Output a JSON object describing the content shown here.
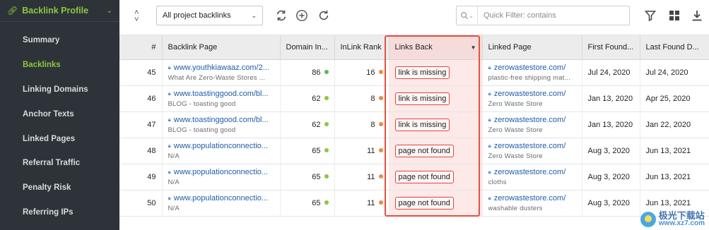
{
  "sidebar": {
    "title": "Backlink Profile",
    "items": [
      {
        "label": "Summary",
        "active": false
      },
      {
        "label": "Backlinks",
        "active": true
      },
      {
        "label": "Linking Domains",
        "active": false
      },
      {
        "label": "Anchor Texts",
        "active": false
      },
      {
        "label": "Linked Pages",
        "active": false
      },
      {
        "label": "Referral Traffic",
        "active": false
      },
      {
        "label": "Penalty Risk",
        "active": false
      },
      {
        "label": "Referring IPs",
        "active": false
      }
    ]
  },
  "toolbar": {
    "select_value": "All project backlinks",
    "filter_placeholder": "Quick Filter: contains"
  },
  "table": {
    "headers": {
      "num": "#",
      "backlink_page": "Backlink Page",
      "domain_inlink": "Domain In...",
      "inlink_rank": "InLink Rank",
      "links_back": "Links Back",
      "linked_page": "Linked Page",
      "first_found": "First Found...",
      "last_found": "Last Found D..."
    },
    "rows": [
      {
        "num": "45",
        "bp_url": "www.youthkiawaaz.com/2...",
        "bp_sub": "What Are Zero-Waste Stores ...",
        "domain": "86",
        "domain_color": "#5cb85c",
        "rank": "16",
        "rank_color": "#f0883e",
        "links_back": "link is missing",
        "lp_url": "zerowastestore.com/",
        "lp_sub": "plastic-free shipping mat...",
        "first": "Jul 24, 2020",
        "last": "Jul 24, 2020"
      },
      {
        "num": "46",
        "bp_url": "www.toastinggood.com/bl...",
        "bp_sub": "BLOG - toasting good",
        "domain": "62",
        "domain_color": "#8cc63f",
        "rank": "8",
        "rank_color": "#f0883e",
        "links_back": "link is missing",
        "lp_url": "zerowastestore.com/",
        "lp_sub": "Zero Waste Store",
        "first": "Jan 13, 2020",
        "last": "Apr 25, 2020"
      },
      {
        "num": "47",
        "bp_url": "www.toastinggood.com/bl...",
        "bp_sub": "BLOG - toasting good",
        "domain": "62",
        "domain_color": "#8cc63f",
        "rank": "8",
        "rank_color": "#f0883e",
        "links_back": "link is missing",
        "lp_url": "zerowastestore.com/",
        "lp_sub": "Zero Waste Store",
        "first": "Jan 13, 2020",
        "last": "Jan 22, 2020"
      },
      {
        "num": "48",
        "bp_url": "www.populationconnectio...",
        "bp_sub": "N/A",
        "domain": "65",
        "domain_color": "#8cc63f",
        "rank": "11",
        "rank_color": "#f0883e",
        "links_back": "page not found",
        "lp_url": "zerowastestore.com/",
        "lp_sub": "Zero Waste Store",
        "first": "Aug 3, 2020",
        "last": "Jun 13, 2021"
      },
      {
        "num": "49",
        "bp_url": "www.populationconnectio...",
        "bp_sub": "N/A",
        "domain": "65",
        "domain_color": "#8cc63f",
        "rank": "11",
        "rank_color": "#f0883e",
        "links_back": "page not found",
        "lp_url": "zerowastestore.com/",
        "lp_sub": "cloths",
        "first": "Aug 3, 2020",
        "last": "Jun 13, 2021"
      },
      {
        "num": "50",
        "bp_url": "www.populationconnectio...",
        "bp_sub": "N/A",
        "domain": "65",
        "domain_color": "#8cc63f",
        "rank": "11",
        "rank_color": "#f0883e",
        "links_back": "page not found",
        "lp_url": "zerowastestore.com/",
        "lp_sub": "washable dusters",
        "first": "Aug 3, 2020",
        "last": "Jun 13, 2021"
      }
    ]
  },
  "watermark": {
    "line1": "极光下载站",
    "line2": "www.xz7.com"
  }
}
